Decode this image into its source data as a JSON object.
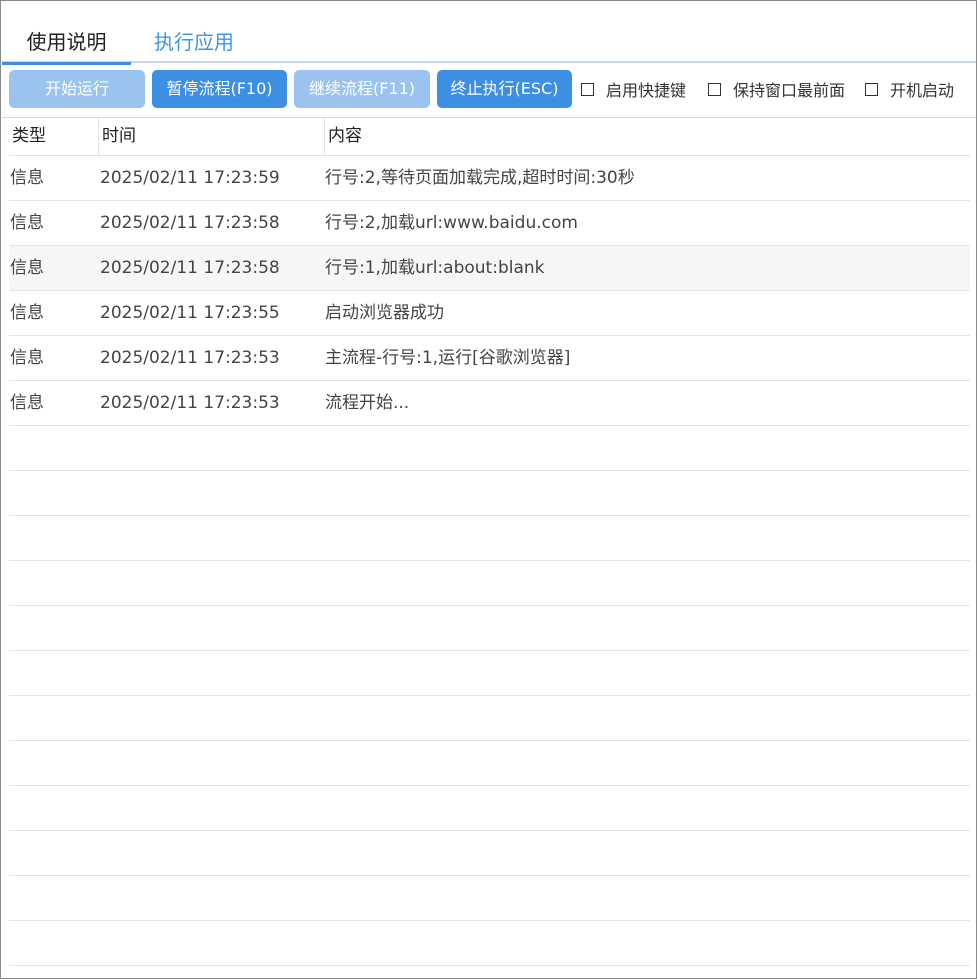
{
  "tabs": [
    {
      "label": "使用说明",
      "active": true
    },
    {
      "label": "执行应用",
      "active": false
    }
  ],
  "toolbar": {
    "start_label": "开始运行",
    "pause_label": "暂停流程(F10)",
    "resume_label": "继续流程(F11)",
    "stop_label": "终止执行(ESC)",
    "checkboxes": [
      {
        "label": "启用快捷键",
        "checked": false
      },
      {
        "label": "保持窗口最前面",
        "checked": false
      },
      {
        "label": "开机启动",
        "checked": false
      }
    ]
  },
  "table": {
    "columns": [
      "类型",
      "时间",
      "内容"
    ],
    "rows": [
      {
        "type": "信息",
        "time": "2025/02/11 17:23:59",
        "content": "行号:2,等待页面加载完成,超时时间:30秒"
      },
      {
        "type": "信息",
        "time": "2025/02/11 17:23:58",
        "content": "行号:2,加载url:www.baidu.com"
      },
      {
        "type": "信息",
        "time": "2025/02/11 17:23:58",
        "content": "行号:1,加载url:about:blank"
      },
      {
        "type": "信息",
        "time": "2025/02/11 17:23:55",
        "content": "启动浏览器成功"
      },
      {
        "type": "信息",
        "time": "2025/02/11 17:23:53",
        "content": "主流程-行号:1,运行[谷歌浏览器]"
      },
      {
        "type": "信息",
        "time": "2025/02/11 17:23:53",
        "content": "流程开始..."
      }
    ],
    "selected_row": 2
  },
  "colors": {
    "accent": "#3c8fe3",
    "accent_disabled": "#9ac4ef",
    "tab_inactive": "#3c97e8",
    "selected_row": "#f4f6f8",
    "grid_line": "#e3e3e3"
  }
}
